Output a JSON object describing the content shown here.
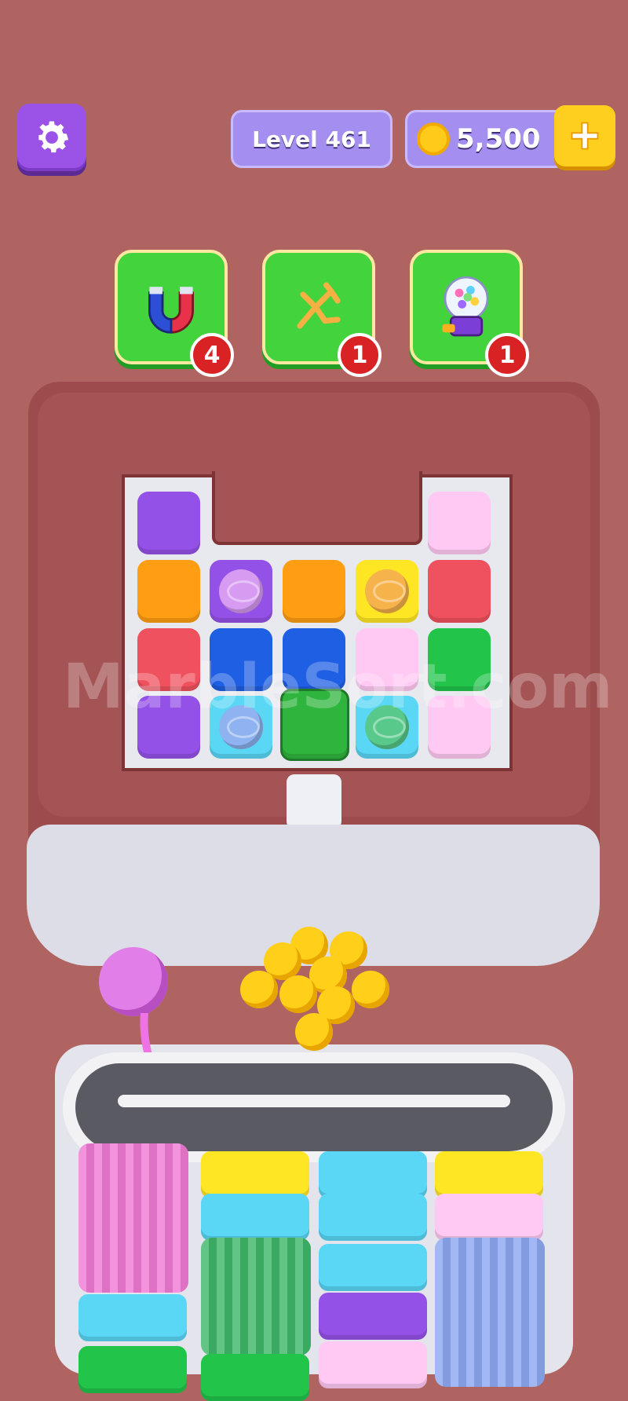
{
  "hud": {
    "level_label": "Level 461",
    "coins": "5,500"
  },
  "boosters": [
    {
      "name": "magnet",
      "count": "4"
    },
    {
      "name": "unravel",
      "count": "1"
    },
    {
      "name": "gumball-machine",
      "count": "1"
    }
  ],
  "watermark": "MarbleSort.com",
  "colors": {
    "background": "#b06462",
    "purple": "#9451e8",
    "orange": "#ff9e12",
    "red": "#f0515e",
    "blue": "#1f5fe3",
    "pink_light": "#ffc9f3",
    "green": "#22c44a",
    "cyan": "#5ad7f5",
    "yellow": "#ffe625",
    "white": "#f0f0f5"
  }
}
